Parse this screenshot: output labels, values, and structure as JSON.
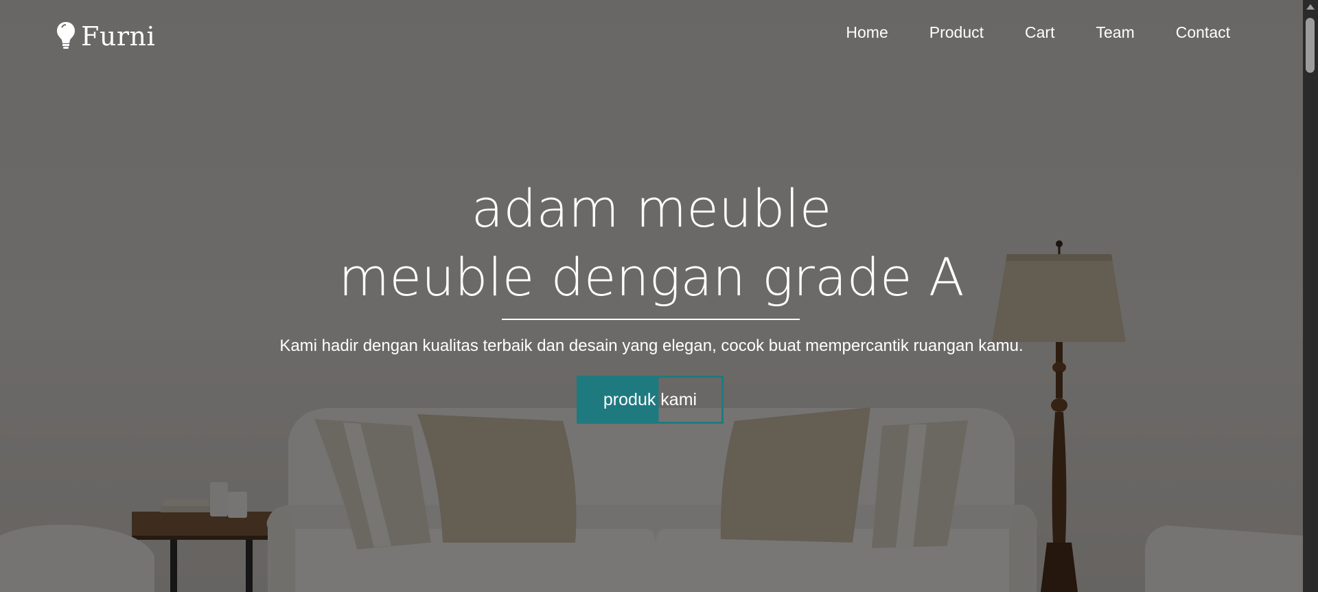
{
  "brand": {
    "name": "Furni",
    "icon": "lightbulb-icon"
  },
  "nav": {
    "items": [
      {
        "label": "Home"
      },
      {
        "label": "Product"
      },
      {
        "label": "Cart"
      },
      {
        "label": "Team"
      },
      {
        "label": "Contact"
      }
    ]
  },
  "hero": {
    "title_line1": "adam meuble",
    "title_line2": "meuble dengan grade A",
    "subtitle": "Kami hadir dengan kualitas terbaik dan desain yang elegan, cocok buat mempercantik ruangan kamu.",
    "cta_label": "produk kami"
  },
  "colors": {
    "accent": "#1f7a80",
    "text": "#ffffff",
    "overlay": "rgba(0,0,0,0.5)"
  }
}
